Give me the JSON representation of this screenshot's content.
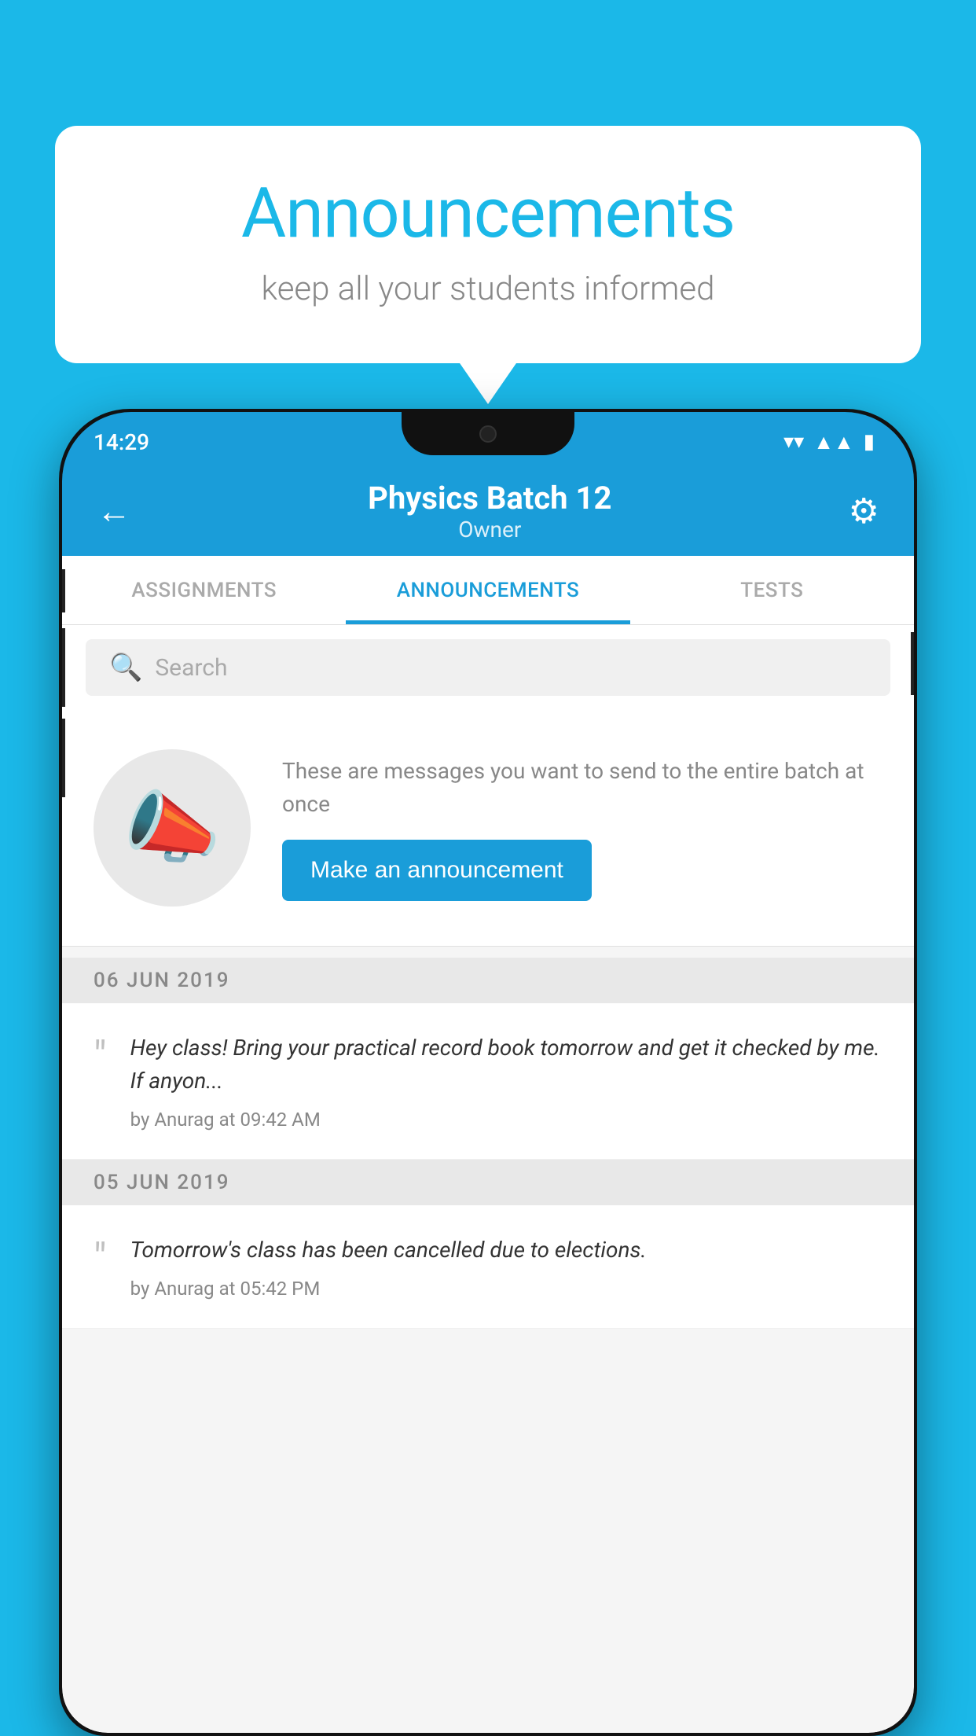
{
  "background_color": "#1BB8E8",
  "bubble": {
    "title": "Announcements",
    "subtitle": "keep all your students informed"
  },
  "phone": {
    "status_bar": {
      "time": "14:29",
      "icons": [
        "wifi",
        "signal",
        "battery"
      ]
    },
    "app_bar": {
      "back_label": "←",
      "title": "Physics Batch 12",
      "subtitle": "Owner",
      "gear_label": "⚙"
    },
    "tabs": [
      {
        "label": "ASSIGNMENTS",
        "active": false
      },
      {
        "label": "ANNOUNCEMENTS",
        "active": true
      },
      {
        "label": "TESTS",
        "active": false
      }
    ],
    "search": {
      "placeholder": "Search"
    },
    "promo": {
      "description": "These are messages you want to send to the entire batch at once",
      "button_label": "Make an announcement"
    },
    "announcements": [
      {
        "date": "06  JUN  2019",
        "text": "Hey class! Bring your practical record book tomorrow and get it checked by me. If anyon...",
        "meta": "by Anurag at 09:42 AM"
      },
      {
        "date": "05  JUN  2019",
        "text": "Tomorrow's class has been cancelled due to elections.",
        "meta": "by Anurag at 05:42 PM"
      }
    ]
  }
}
